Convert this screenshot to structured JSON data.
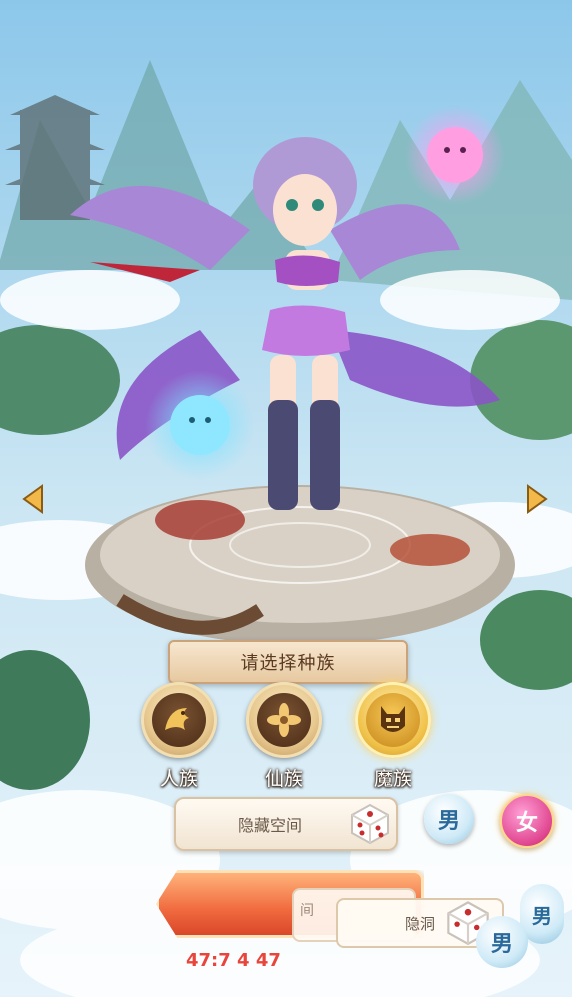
{
  "banner": {
    "text": "请选择种族"
  },
  "races": [
    {
      "label": "人族",
      "icon": "dragon-icon",
      "selected": false
    },
    {
      "label": "仙族",
      "icon": "lotus-icon",
      "selected": false
    },
    {
      "label": "魔族",
      "icon": "demon-mask-icon",
      "selected": true
    }
  ],
  "name_field": {
    "value": "隐藏空间"
  },
  "gender": {
    "male": "男",
    "female": "女",
    "selected": "female"
  },
  "overlay": {
    "text_a": "间",
    "text_b": "隐洞",
    "right_label": "男",
    "male_label": "男"
  },
  "footer": {
    "counter": "47:7 4 47"
  },
  "colors": {
    "accent": "#f06a3e",
    "female": "#e0468f",
    "male": "#2a6a9a",
    "banner_text": "#5b3a22"
  }
}
